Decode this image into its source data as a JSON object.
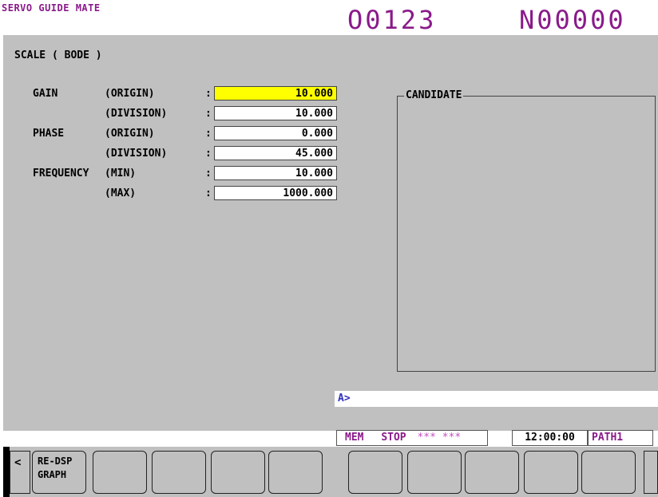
{
  "header": {
    "app_title": "SERVO GUIDE MATE",
    "program_number": "O0123",
    "sequence_number": "N00000"
  },
  "screen": {
    "title": "SCALE ( BODE )"
  },
  "params": [
    {
      "group": "GAIN",
      "sub": "(ORIGIN)",
      "value": "10.000",
      "active": true
    },
    {
      "group": "",
      "sub": "(DIVISION)",
      "value": "10.000",
      "active": false
    },
    {
      "group": "PHASE",
      "sub": "(ORIGIN)",
      "value": "0.000",
      "active": false
    },
    {
      "group": "",
      "sub": "(DIVISION)",
      "value": "45.000",
      "active": false
    },
    {
      "group": "FREQUENCY",
      "sub": "(MIN)",
      "value": "10.000",
      "active": false
    },
    {
      "group": "",
      "sub": "(MAX)",
      "value": "1000.000",
      "active": false
    }
  ],
  "colon": ":",
  "candidate": {
    "title": "CANDIDATE"
  },
  "input": {
    "prompt": "A>",
    "value": ""
  },
  "status": {
    "mode": "MEM",
    "state": "STOP",
    "stars": "*** ***",
    "time": "12:00:00",
    "path": "PATH1"
  },
  "softkeys": {
    "left_arrow": "<",
    "keys": [
      {
        "label_line1": "RE-DSP",
        "label_line2": "GRAPH"
      },
      {
        "label_line1": "",
        "label_line2": ""
      },
      {
        "label_line1": "",
        "label_line2": ""
      },
      {
        "label_line1": "",
        "label_line2": ""
      },
      {
        "label_line1": "",
        "label_line2": ""
      },
      {
        "label_line1": "",
        "label_line2": ""
      },
      {
        "label_line1": "",
        "label_line2": ""
      },
      {
        "label_line1": "",
        "label_line2": ""
      },
      {
        "label_line1": "",
        "label_line2": ""
      },
      {
        "label_line1": "",
        "label_line2": ""
      },
      {
        "label_line1": "",
        "label_line2": ""
      }
    ]
  },
  "colors": {
    "header_text": "#8a1a8a",
    "panel_bg": "#c0c0c0",
    "active_field": "#ffff00",
    "prompt": "#3030c0"
  }
}
